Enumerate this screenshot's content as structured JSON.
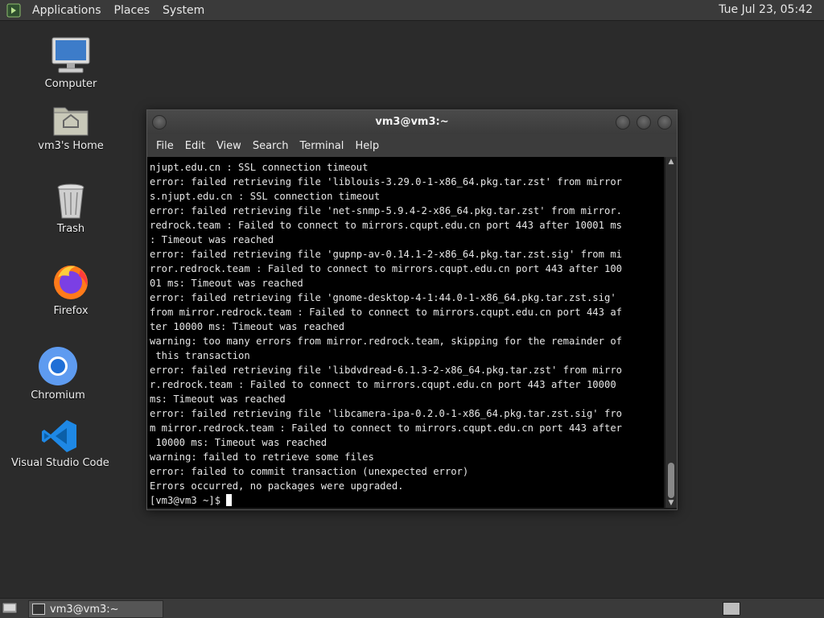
{
  "top_panel": {
    "menus": [
      "Applications",
      "Places",
      "System"
    ],
    "clock": "Tue Jul 23, 05:42"
  },
  "desktop_icons": [
    {
      "label": "Computer",
      "icon": "computer-icon"
    },
    {
      "label": "vm3's Home",
      "icon": "home-folder-icon"
    },
    {
      "label": "Trash",
      "icon": "trash-icon"
    },
    {
      "label": "Firefox",
      "icon": "firefox-icon"
    },
    {
      "label": "Chromium",
      "icon": "chromium-icon"
    },
    {
      "label": "Visual Studio Code",
      "icon": "vscode-icon"
    }
  ],
  "terminal": {
    "title": "vm3@vm3:~",
    "menu": [
      "File",
      "Edit",
      "View",
      "Search",
      "Terminal",
      "Help"
    ],
    "lines": [
      "njupt.edu.cn : SSL connection timeout",
      "error: failed retrieving file 'liblouis-3.29.0-1-x86_64.pkg.tar.zst' from mirror",
      "s.njupt.edu.cn : SSL connection timeout",
      "error: failed retrieving file 'net-snmp-5.9.4-2-x86_64.pkg.tar.zst' from mirror.",
      "redrock.team : Failed to connect to mirrors.cqupt.edu.cn port 443 after 10001 ms",
      ": Timeout was reached",
      "error: failed retrieving file 'gupnp-av-0.14.1-2-x86_64.pkg.tar.zst.sig' from mi",
      "rror.redrock.team : Failed to connect to mirrors.cqupt.edu.cn port 443 after 100",
      "01 ms: Timeout was reached",
      "error: failed retrieving file 'gnome-desktop-4-1:44.0-1-x86_64.pkg.tar.zst.sig'",
      "from mirror.redrock.team : Failed to connect to mirrors.cqupt.edu.cn port 443 af",
      "ter 10000 ms: Timeout was reached",
      "warning: too many errors from mirror.redrock.team, skipping for the remainder of",
      " this transaction",
      "error: failed retrieving file 'libdvdread-6.1.3-2-x86_64.pkg.tar.zst' from mirro",
      "r.redrock.team : Failed to connect to mirrors.cqupt.edu.cn port 443 after 10000",
      "ms: Timeout was reached",
      "error: failed retrieving file 'libcamera-ipa-0.2.0-1-x86_64.pkg.tar.zst.sig' fro",
      "m mirror.redrock.team : Failed to connect to mirrors.cqupt.edu.cn port 443 after",
      " 10000 ms: Timeout was reached",
      "warning: failed to retrieve some files",
      "error: failed to commit transaction (unexpected error)",
      "Errors occurred, no packages were upgraded."
    ],
    "prompt": "[vm3@vm3 ~]$ "
  },
  "taskbar": {
    "task_label": "vm3@vm3:~"
  }
}
